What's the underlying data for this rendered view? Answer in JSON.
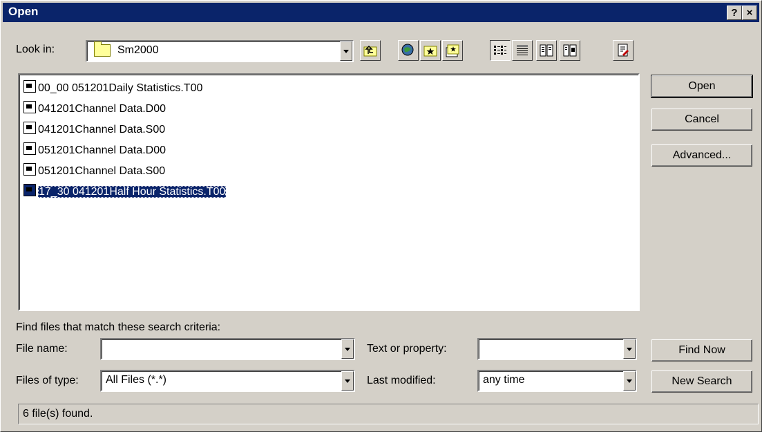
{
  "window": {
    "title": "Open",
    "help_button": "?",
    "close_button": "×"
  },
  "look_in": {
    "label": "Look in:",
    "value": "Sm2000"
  },
  "toolbar": {
    "icons": [
      "up-one-level-icon",
      "search-web-icon",
      "look-in-favorites-icon",
      "add-to-favorites-icon",
      "list-view-icon",
      "details-view-icon",
      "properties-view-icon",
      "preview-view-icon",
      "commands-and-settings-icon"
    ]
  },
  "files": [
    {
      "name": "00_00 051201Daily Statistics.T00",
      "selected": false
    },
    {
      "name": "041201Channel Data.D00",
      "selected": false
    },
    {
      "name": "041201Channel Data.S00",
      "selected": false
    },
    {
      "name": "051201Channel Data.D00",
      "selected": false
    },
    {
      "name": "051201Channel Data.S00",
      "selected": false
    },
    {
      "name": "17_30 041201Half Hour Statistics.T00",
      "selected": true
    }
  ],
  "buttons": {
    "open": "Open",
    "cancel": "Cancel",
    "advanced": "Advanced...",
    "find_now": "Find Now",
    "new_search": "New Search"
  },
  "search": {
    "heading": "Find files that match these search criteria:",
    "file_name_label": "File name:",
    "file_name_value": "",
    "files_of_type_label": "Files of type:",
    "files_of_type_value": "All Files (*.*)",
    "text_property_label": "Text or property:",
    "text_property_value": "",
    "last_modified_label": "Last modified:",
    "last_modified_value": "any time"
  },
  "status": {
    "text": "6 file(s) found."
  },
  "colors": {
    "title_bar": "#0a246a",
    "face": "#d4d0c8",
    "selection": "#0a246a"
  }
}
